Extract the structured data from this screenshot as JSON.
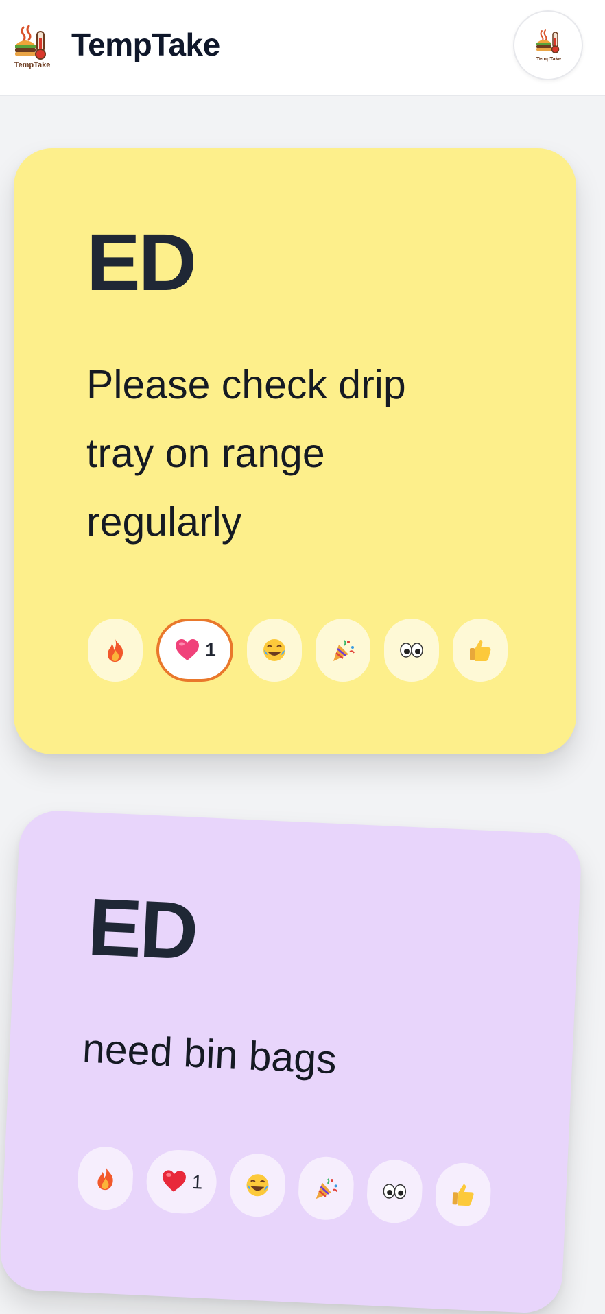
{
  "header": {
    "app_name": "TempTake",
    "logo_text": "TempTake",
    "avatar_logo_text": "TempTake"
  },
  "notes": [
    {
      "author": "ED",
      "message": "Please check drip tray on range regularly",
      "color": "#fdef8b",
      "reactions": [
        {
          "icon": "fire-icon",
          "count": ""
        },
        {
          "icon": "heart-icon",
          "count": "1",
          "active": true
        },
        {
          "icon": "laughing-icon",
          "count": ""
        },
        {
          "icon": "party-popper-icon",
          "count": ""
        },
        {
          "icon": "eyes-icon",
          "count": ""
        },
        {
          "icon": "thumbs-up-icon",
          "count": ""
        }
      ]
    },
    {
      "author": "ED",
      "message": "need bin bags",
      "color": "#e8d5fb",
      "reactions": [
        {
          "icon": "fire-icon",
          "count": ""
        },
        {
          "icon": "heart-icon",
          "count": "1"
        },
        {
          "icon": "laughing-icon",
          "count": ""
        },
        {
          "icon": "party-popper-icon",
          "count": ""
        },
        {
          "icon": "eyes-icon",
          "count": ""
        },
        {
          "icon": "thumbs-up-icon",
          "count": ""
        }
      ]
    }
  ],
  "colors": {
    "accent_orange": "#e9782b",
    "header_bg": "#ffffff",
    "page_bg": "#f2f3f5"
  }
}
